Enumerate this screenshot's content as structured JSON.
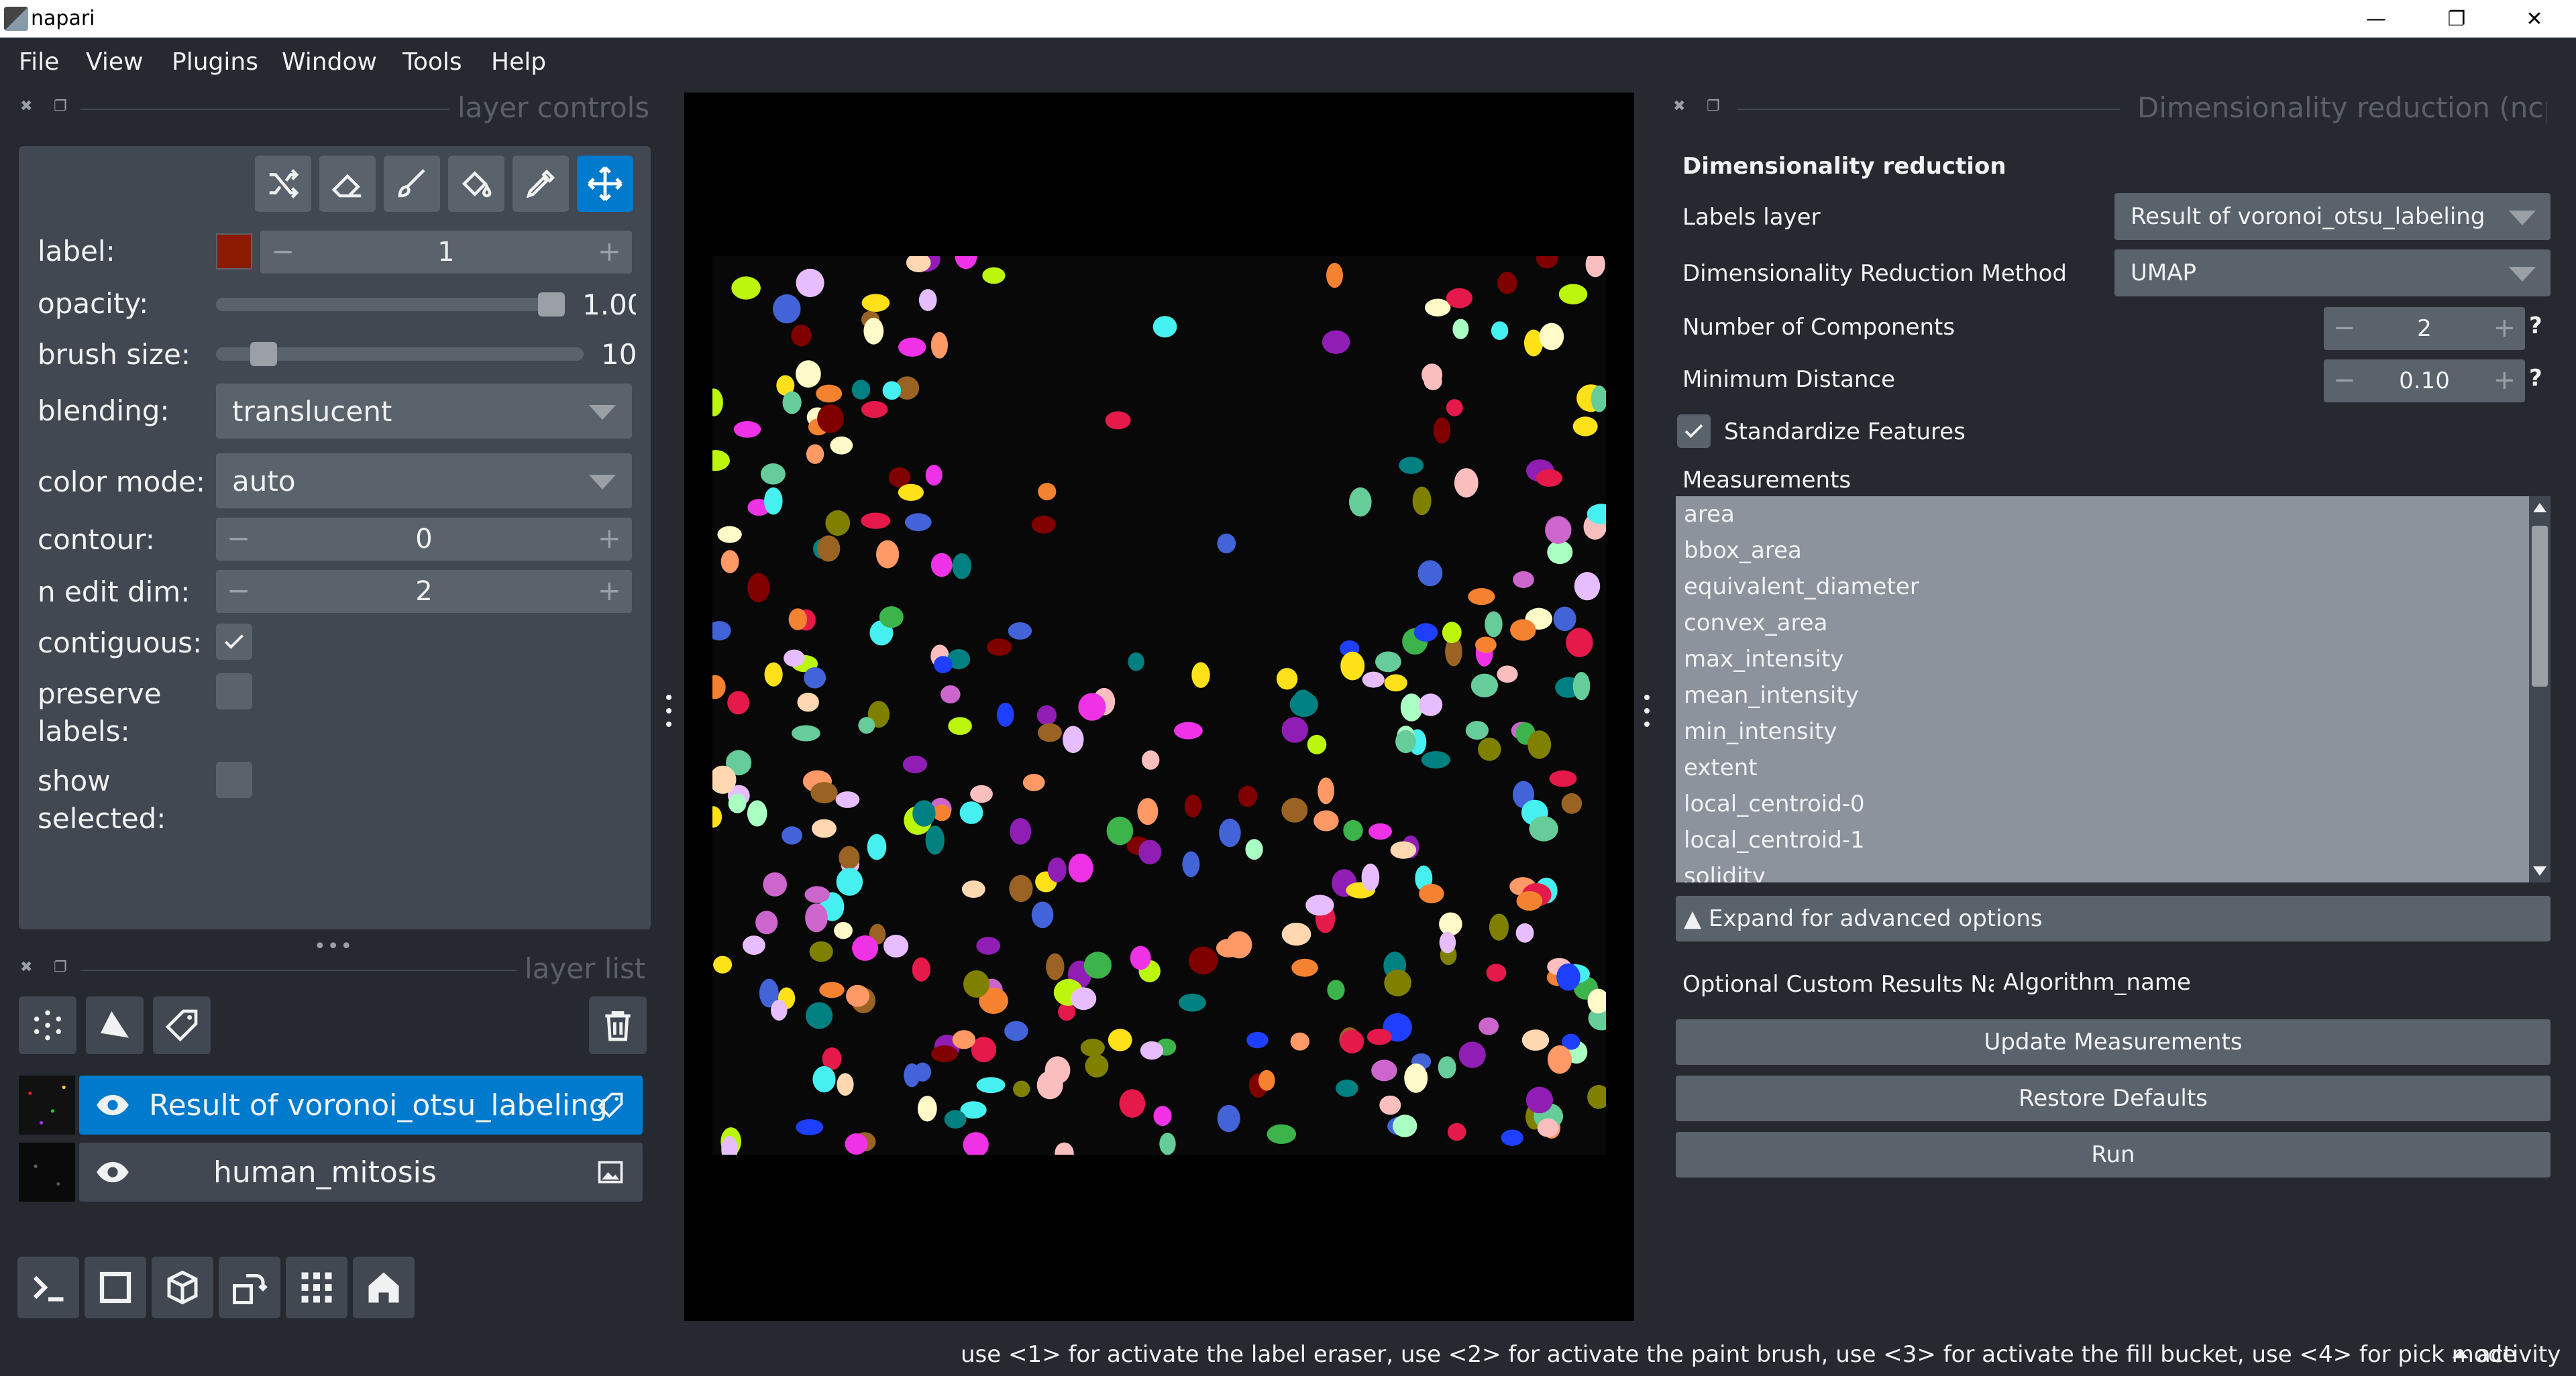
{
  "window": {
    "title": "napari",
    "minimize": "—",
    "restore": "❐",
    "close": "✕"
  },
  "menu": [
    "File",
    "View",
    "Plugins",
    "Window",
    "Tools",
    "Help"
  ],
  "layer_controls": {
    "panel_title": "layer controls",
    "label_label": "label:",
    "label_color": "#8b1a00",
    "label_value": "1",
    "opacity_label": "opacity:",
    "opacity_value": "1.00",
    "opacity_level": 1.0,
    "brush_label": "brush size:",
    "brush_value": "10",
    "brush_level": 0.1,
    "blending_label": "blending:",
    "blending_value": "translucent",
    "color_mode_label": "color mode:",
    "color_mode_value": "auto",
    "contour_label": "contour:",
    "contour_value": "0",
    "n_edit_dim_label": "n edit dim:",
    "n_edit_dim_value": "2",
    "contiguous_label": "contiguous:",
    "preserve_label_1": "preserve",
    "preserve_label_2": "labels:",
    "show_selected_1": "show",
    "show_selected_2": "selected:",
    "tools": [
      "shuffle-icon",
      "eraser-icon",
      "paint-brush-icon",
      "fill-bucket-icon",
      "picker-icon",
      "move-icon"
    ]
  },
  "layer_list": {
    "panel_title": "layer list",
    "layers": [
      {
        "name": "Result of voronoi_otsu_labeling",
        "selected": true,
        "type": "labels"
      },
      {
        "name": "human_mitosis",
        "selected": false,
        "type": "image"
      }
    ]
  },
  "right_panel": {
    "dock_title": "Dimensionality reduction (ncp)",
    "heading": "Dimensionality reduction",
    "labels_layer_label": "Labels layer",
    "labels_layer_value": "Result of voronoi_otsu_labeling",
    "method_label": "Dimensionality Reduction Method",
    "method_value": "UMAP",
    "n_components_label": "Number of Components",
    "n_components_value": "2",
    "min_distance_label": "Minimum Distance",
    "min_distance_value": "0.10",
    "help_mark": "?",
    "standardize_label": "Standardize Features",
    "measurements_label": "Measurements",
    "measurements": [
      "area",
      "bbox_area",
      "equivalent_diameter",
      "convex_area",
      "max_intensity",
      "mean_intensity",
      "min_intensity",
      "extent",
      "local_centroid-0",
      "local_centroid-1",
      "solidity"
    ],
    "expand_label": "▲ Expand for advanced options",
    "custom_name_label": "Optional Custom Results Name",
    "custom_name_value": "Algorithm_name",
    "update_button": "Update Measurements",
    "restore_button": "Restore Defaults",
    "run_button": "Run"
  },
  "status": {
    "hint": "use <1> for activate the label eraser, use <2> for activate the paint brush, use <3> for activate the fill bucket, use <4> for pick mode",
    "activity": "⏶ activity"
  }
}
